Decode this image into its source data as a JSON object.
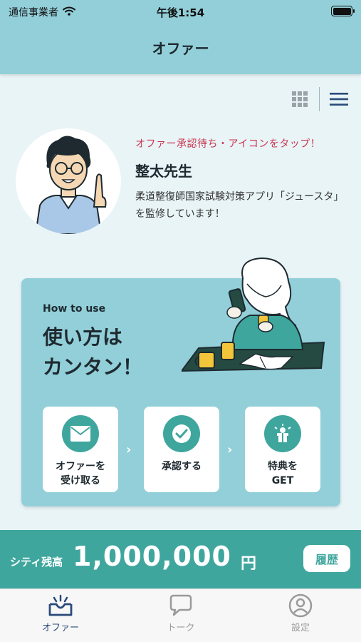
{
  "status_bar": {
    "carrier": "通信事業者",
    "time": "午後1:54"
  },
  "nav": {
    "title": "オファー"
  },
  "icons": {
    "grid": "grid-view-icon",
    "list": "list-view-icon",
    "mail": "mail-icon",
    "check": "check-icon",
    "gift": "gift-icon",
    "offer_tab": "offer-inbox-icon",
    "talk_tab": "chat-bubble-icon",
    "settings_tab": "user-circle-icon"
  },
  "colors": {
    "header": "#92cfd9",
    "accent": "#3fa69e",
    "alert": "#c8344f",
    "background": "#e9f4f7",
    "tab_active": "#2a4a7a"
  },
  "profile": {
    "status": "オファー承認待ち・アイコンをタップ！",
    "name": "整太先生",
    "description": "柔道整復師国家試験対策アプリ「ジュースタ」を監修しています！"
  },
  "howto": {
    "subtitle": "How to use",
    "title_line1": "使い方は",
    "title_line2": "カンタン！",
    "steps": [
      {
        "line1": "オファーを",
        "line2": "受け取る"
      },
      {
        "line1": "承認する",
        "line2": ""
      },
      {
        "line1": "特典を",
        "line2": "GET"
      }
    ],
    "arrow": "›"
  },
  "balance": {
    "label": "シティ残高",
    "amount": "1,000,000",
    "unit": "円",
    "history_label": "履歴"
  },
  "tabs": [
    {
      "label": "オファー",
      "active": true
    },
    {
      "label": "トーク",
      "active": false
    },
    {
      "label": "設定",
      "active": false
    }
  ]
}
